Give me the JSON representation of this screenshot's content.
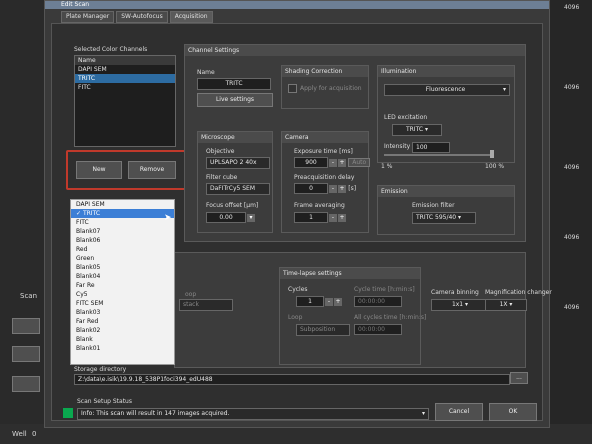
{
  "dialog": {
    "title": "Edit Scan",
    "tabs": [
      "Plate Manager",
      "SW-Autofocus",
      "Acquisition"
    ]
  },
  "channels": {
    "section_label": "Selected Color Channels",
    "list_header": "Name",
    "items": [
      "DAPI SEM",
      "TRITC",
      "FITC"
    ],
    "new_label": "New",
    "remove_label": "Remove"
  },
  "dropdown": {
    "items": [
      "DAPI SEM",
      "TRITC",
      "FITC",
      "Blank07",
      "Blank06",
      "Red",
      "Green",
      "Blank05",
      "Blank04",
      "Far Re",
      "Cy5",
      "FITC SEM",
      "Blank03",
      "Far Red",
      "Blank02",
      "Blank",
      "Blank01"
    ]
  },
  "channel_settings": {
    "title": "Channel Settings",
    "name_label": "Name",
    "name_value": "TRITC",
    "live_settings": "Live settings"
  },
  "shading": {
    "title": "Shading Correction",
    "apply_label": "Apply for acquisition"
  },
  "illumination": {
    "title": "Illumination",
    "mode": "Fluorescence",
    "led_label": "LED excitation",
    "led_value": "TRITC",
    "intensity_label": "Intensity",
    "intensity_value": "100",
    "min": "1 %",
    "max": "100 %"
  },
  "microscope": {
    "title": "Microscope",
    "objective_label": "Objective",
    "objective_value": "UPLSAPO 2 40x",
    "filter_label": "Filter cube",
    "filter_value": "DaFITrCy5 SEM",
    "focus_label": "Focus offset [μm]",
    "focus_value": "0.00"
  },
  "camera": {
    "title": "Camera",
    "exposure_label": "Exposure time [ms]",
    "exposure_value": "900",
    "auto_label": "Auto",
    "delay_label": "Preacquisition delay",
    "delay_value": "0",
    "delay_unit": "[s]",
    "averaging_label": "Frame averaging",
    "averaging_value": "1"
  },
  "emission": {
    "title": "Emission",
    "filter_label": "Emission filter",
    "filter_value": "TRITC 595/40"
  },
  "timelapse": {
    "title": "Time-lapse settings",
    "cycles_label": "Cycles",
    "cycles_value": "1",
    "cycle_time_label": "Cycle time [h:min:s]",
    "cycle_time_value": "00:00:00",
    "loop_label": "Loop",
    "loop_value": "Subposition",
    "all_cycles_label": "All cycles time [h:min:s]",
    "all_cycles_value": "00:00:00",
    "left_loop_label": "oop",
    "left_loop_value": "stack"
  },
  "binning": {
    "label": "Camera binning",
    "value": "1x1"
  },
  "magnification": {
    "label": "Magnification changer",
    "value": "1X"
  },
  "storage": {
    "label": "Storage directory",
    "path": "Z:\\data\\e.isik\\19.9.18_538P1foci394_edU488",
    "browse": "..."
  },
  "status": {
    "label": "Scan Setup Status",
    "message": "Info: This scan will result in 147 images acquired."
  },
  "buttons": {
    "cancel": "Cancel",
    "ok": "OK"
  },
  "background": {
    "scan_label": "Scan",
    "well_label": "Well",
    "well_value": "0",
    "right_numbers": [
      "4096",
      "4096",
      "4096",
      "4096",
      "4096"
    ]
  }
}
